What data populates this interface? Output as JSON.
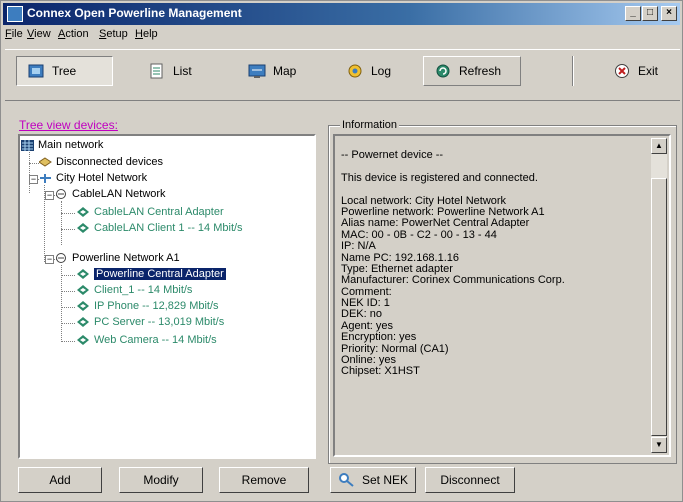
{
  "window": {
    "title": "Connex Open Powerline Management",
    "min": "_",
    "max": "□",
    "close": "×"
  },
  "menu": [
    "File",
    "View",
    "Action",
    "Setup",
    "Help"
  ],
  "toolbar": {
    "tree": "Tree",
    "list": "List",
    "map": "Map",
    "log": "Log",
    "refresh": "Refresh",
    "exit": "Exit"
  },
  "tree": {
    "label": "Tree view devices:",
    "nodes": {
      "main": "Main network",
      "disconnected": "Disconnected devices",
      "city": "City Hotel Network",
      "cablelan": "CableLAN Network",
      "cablelan_adapter": "CableLAN Central Adapter",
      "cablelan_client": "CableLAN Client 1 -- 14 Mbit/s",
      "powerline": "Powerline Network A1",
      "pl_adapter": "Powerline Central Adapter",
      "client1": "Client_1 -- 14 Mbit/s",
      "ipphone": "IP Phone -- 12,829 Mbit/s",
      "pcserver": "PC Server -- 13,019 Mbit/s",
      "webcam": "Web Camera -- 14 Mbit/s"
    }
  },
  "info": {
    "legend": "Information",
    "lines": [
      "-- Powernet device --",
      "",
      "This device is registered and connected.",
      "",
      "Local network: City Hotel Network",
      "Powerline network: Powerline Network A1",
      "Alias name: PowerNet Central Adapter",
      "MAC: 00 - 0B - C2 - 00 - 13 - 44",
      "IP: N/A",
      "Name PC: 192.168.1.16",
      "Type: Ethernet adapter",
      "Manufacturer: Corinex Communications Corp.",
      "Comment:",
      "NEK ID: 1",
      "DEK: no",
      "Agent: yes",
      "Encryption: yes",
      "Priority: Normal (CA1)",
      "Online: yes",
      "Chipset: X1HST"
    ]
  },
  "buttons": {
    "add": "Add",
    "modify": "Modify",
    "remove": "Remove",
    "setnek": "Set NEK",
    "disconnect": "Disconnect"
  },
  "colors": {
    "title_start": "#0a246a",
    "title_end": "#a6caf0",
    "tree_label": "#c000c0",
    "device_text": "#2c8a6a",
    "selection": "#0a246a"
  }
}
